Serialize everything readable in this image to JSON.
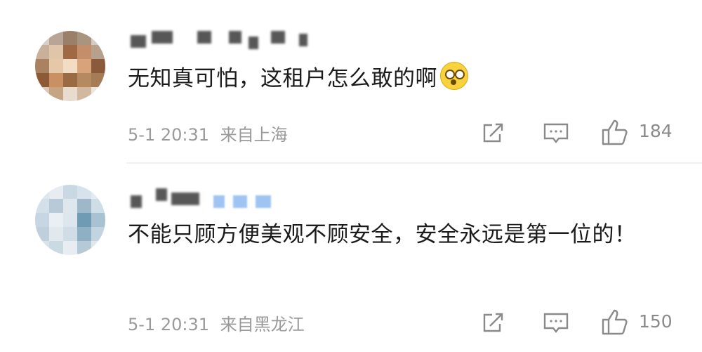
{
  "comments": [
    {
      "text": "无知真可怕，这租户怎么敢的啊",
      "emoji": "astonished-face-emoji",
      "time": "5-1 20:31",
      "location": "来自上海",
      "likes": "184"
    },
    {
      "text": "不能只顾方便美观不顾安全，安全永远是第一位的！",
      "time": "5-1 20:31",
      "location": "来自黑龙江",
      "likes": "150"
    }
  ],
  "icons": {
    "share": "share-icon",
    "comment": "comment-icon",
    "like": "like-icon"
  },
  "colors": {
    "text": "#1b1b1b",
    "meta": "#9a9a9a",
    "icon": "#888888",
    "divider": "#f1f1f1",
    "name_tag_blue": "#9fc4f2"
  }
}
